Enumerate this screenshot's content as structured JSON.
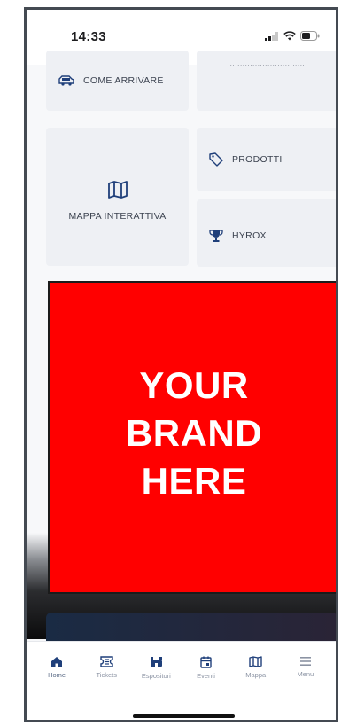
{
  "status_bar": {
    "time": "14:33"
  },
  "tiles": {
    "come_arrivare": "COME ARRIVARE",
    "top_right_partial": "..............................",
    "mappa_interattiva": "MAPPA INTERATTIVA",
    "prodotti": "PRODOTTI",
    "hyrox": "HYROX"
  },
  "ad": {
    "text": "YOUR\nBRAND\nHERE",
    "color": "#ff0000"
  },
  "tab_bar": {
    "items": [
      {
        "label": "Home",
        "icon": "home-icon"
      },
      {
        "label": "Tickets",
        "icon": "ticket-icon"
      },
      {
        "label": "Espositori",
        "icon": "exhibitor-icon"
      },
      {
        "label": "Eventi",
        "icon": "calendar-icon"
      },
      {
        "label": "Mappa",
        "icon": "map-icon"
      },
      {
        "label": "Menu",
        "icon": "menu-icon"
      }
    ]
  },
  "colors": {
    "accent": "#1f3f7a",
    "text": "#3c4350",
    "tile_bg": "#eef0f4"
  }
}
